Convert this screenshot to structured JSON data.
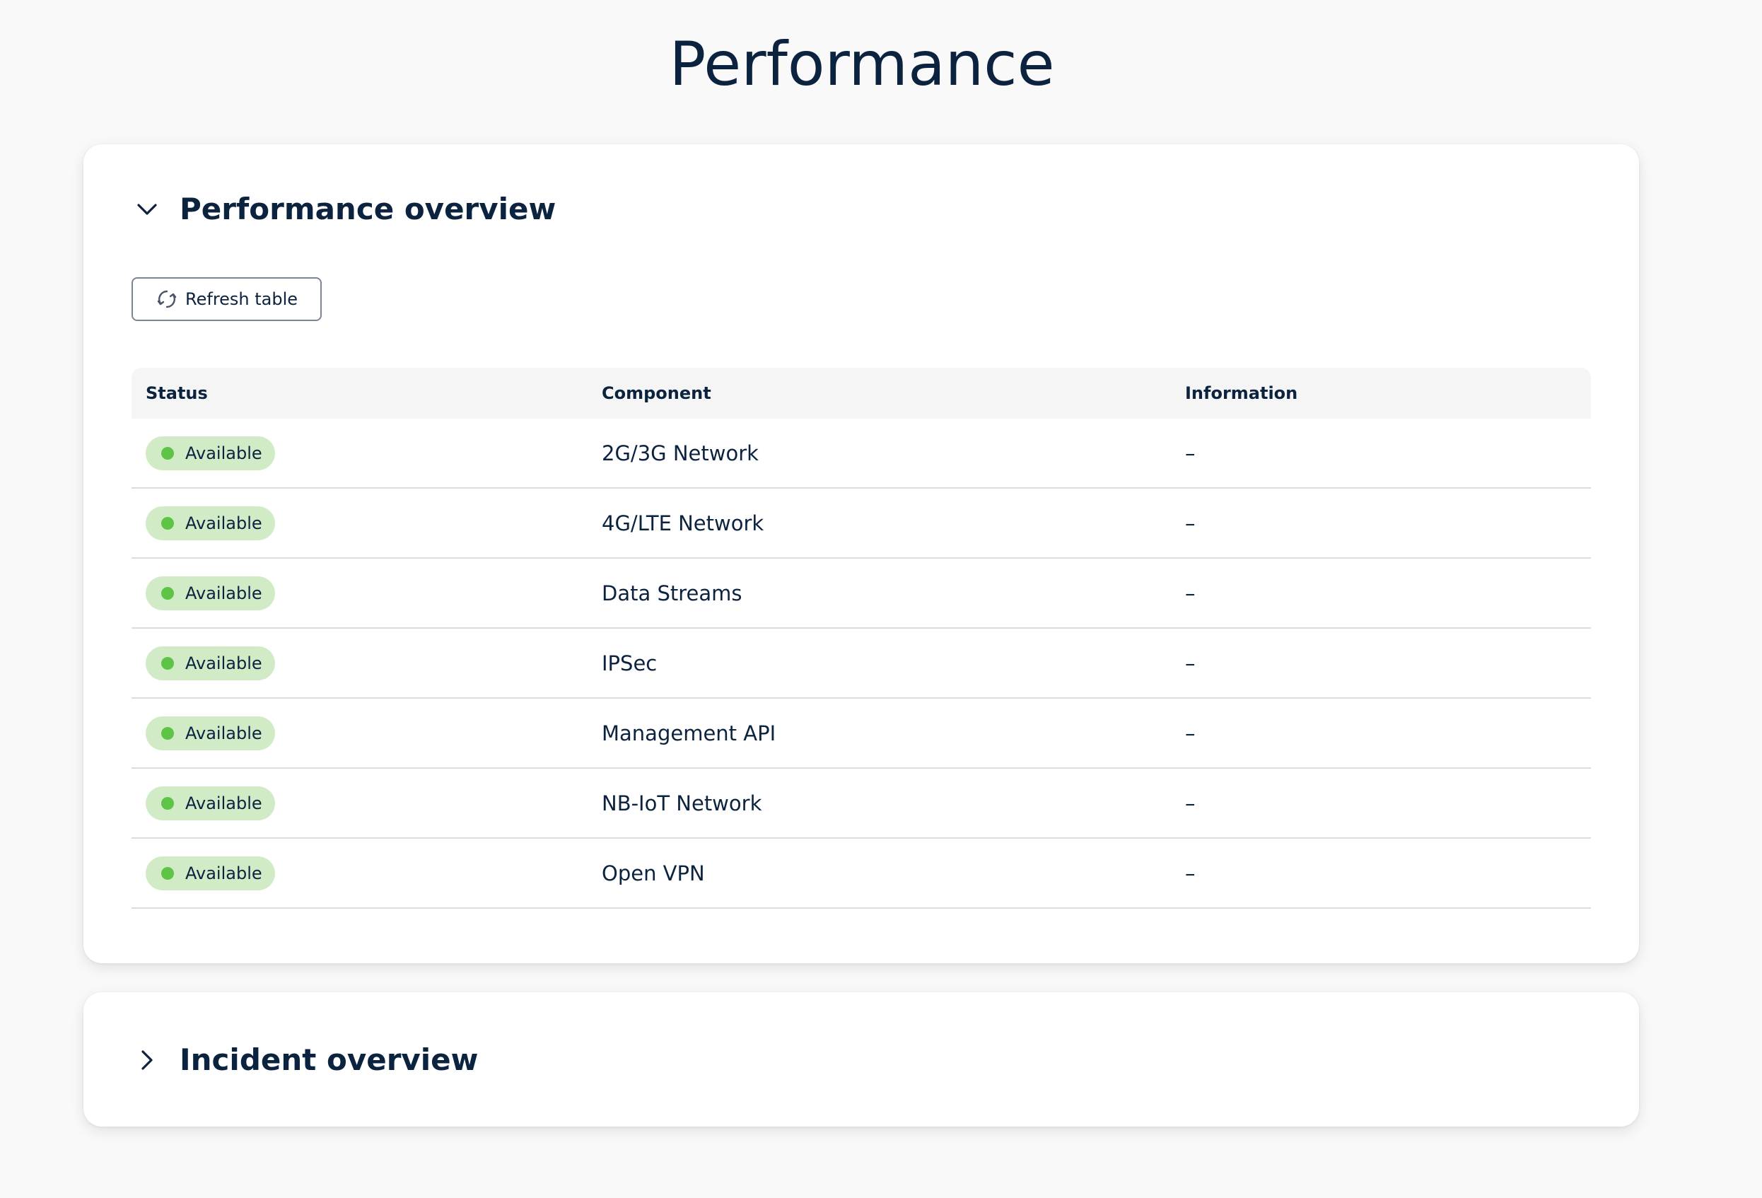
{
  "page": {
    "title": "Performance"
  },
  "performance_panel": {
    "title": "Performance overview",
    "expanded_icon": "chevron-down-icon",
    "refresh_label": "Refresh table",
    "refresh_icon": "refresh-icon",
    "columns": {
      "status": "Status",
      "component": "Component",
      "information": "Information"
    },
    "rows": [
      {
        "status": "Available",
        "component": "2G/3G Network",
        "information": "–"
      },
      {
        "status": "Available",
        "component": "4G/LTE Network",
        "information": "–"
      },
      {
        "status": "Available",
        "component": "Data Streams",
        "information": "–"
      },
      {
        "status": "Available",
        "component": "IPSec",
        "information": "–"
      },
      {
        "status": "Available",
        "component": "Management API",
        "information": "–"
      },
      {
        "status": "Available",
        "component": "NB-IoT Network",
        "information": "–"
      },
      {
        "status": "Available",
        "component": "Open VPN",
        "information": "–"
      }
    ]
  },
  "incident_panel": {
    "title": "Incident overview",
    "collapsed_icon": "chevron-right-icon"
  },
  "colors": {
    "title_text": "#0c2340",
    "badge_bg": "#d1ebc7",
    "badge_dot": "#5dc446",
    "background": "#f9f9f9"
  }
}
